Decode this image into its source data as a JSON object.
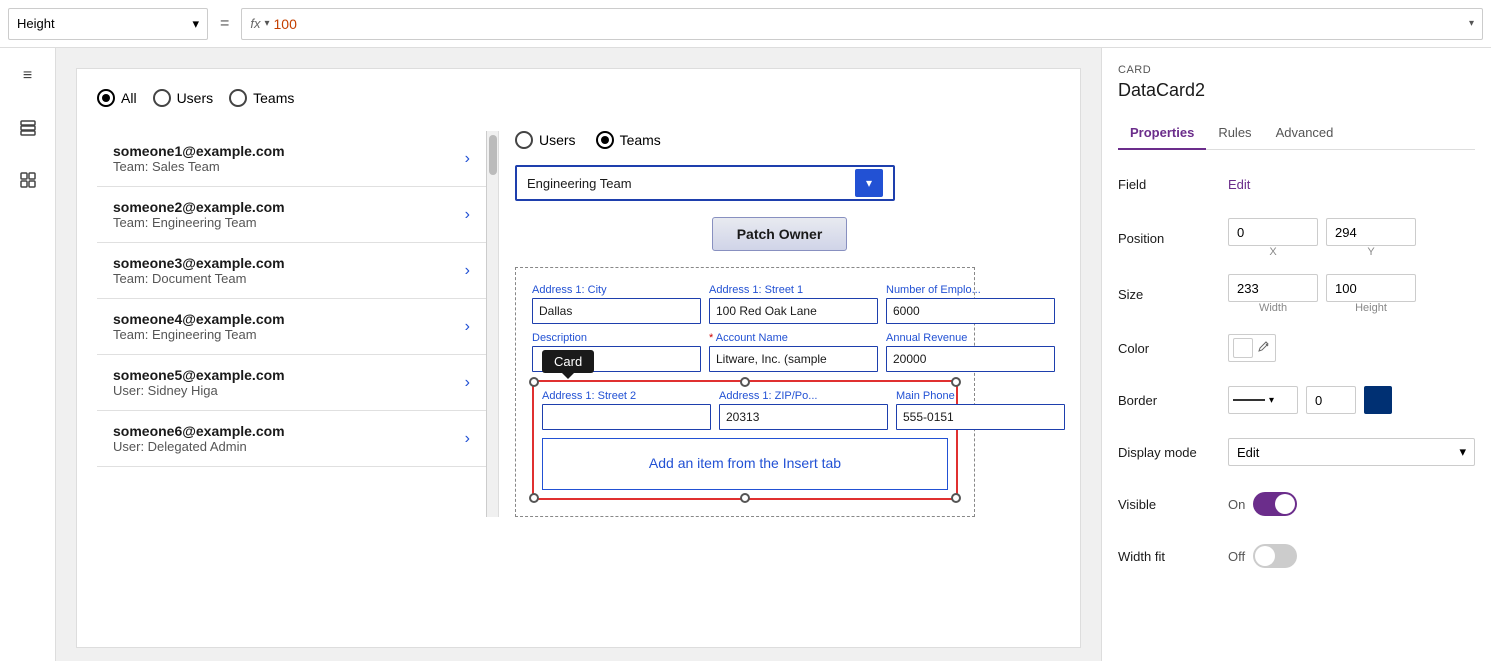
{
  "topbar": {
    "height_label": "Height",
    "equals_symbol": "=",
    "fx_label": "fx",
    "fx_value": "100"
  },
  "sidebar_icons": [
    {
      "name": "hamburger-icon",
      "symbol": "≡"
    },
    {
      "name": "layers-icon",
      "symbol": "⧉"
    },
    {
      "name": "grid-icon",
      "symbol": "⊞"
    }
  ],
  "canvas": {
    "radio_group": {
      "all_label": "All",
      "users_label": "Users",
      "teams_label": "Teams"
    },
    "people": [
      {
        "email": "someone1@example.com",
        "team": "Team: Sales Team"
      },
      {
        "email": "someone2@example.com",
        "team": "Team: Engineering Team"
      },
      {
        "email": "someone3@example.com",
        "team": "Team: Document Team"
      },
      {
        "email": "someone4@example.com",
        "team": "Team: Engineering Team"
      },
      {
        "email": "someone5@example.com",
        "team": "User: Sidney Higa"
      },
      {
        "email": "someone6@example.com",
        "team": "User: Delegated Admin"
      }
    ],
    "form": {
      "radio_users_label": "Users",
      "radio_teams_label": "Teams",
      "dropdown_value": "Engineering Team",
      "patch_owner_label": "Patch Owner",
      "card_tooltip": "Card",
      "insert_placeholder": "Add an item from the Insert tab",
      "fields": [
        {
          "label": "Address 1: City",
          "value": "Dallas",
          "required": false
        },
        {
          "label": "Address 1: Street 1",
          "value": "100 Red Oak Lane",
          "required": false
        },
        {
          "label": "Number of Emplo...",
          "value": "6000",
          "required": false
        },
        {
          "label": "Description",
          "value": "",
          "required": false
        },
        {
          "label": "Account Name",
          "value": "Litware, Inc. (sample",
          "required": true
        },
        {
          "label": "Annual Revenue",
          "value": "20000",
          "required": false
        },
        {
          "label": "Address 1: Street 2",
          "value": "",
          "required": false
        },
        {
          "label": "Address 1: ZIP/Po...",
          "value": "20313",
          "required": false
        },
        {
          "label": "Main Phone",
          "value": "555-0151",
          "required": false
        }
      ]
    }
  },
  "props_panel": {
    "card_label": "CARD",
    "title": "DataCard2",
    "tabs": [
      "Properties",
      "Rules",
      "Advanced"
    ],
    "active_tab": "Properties",
    "field_label": "Field",
    "field_edit": "Edit",
    "position_label": "Position",
    "position_x": "0",
    "position_y": "294",
    "x_label": "X",
    "y_label": "Y",
    "size_label": "Size",
    "size_width": "233",
    "size_height": "100",
    "width_label": "Width",
    "height_label": "Height",
    "color_label": "Color",
    "border_label": "Border",
    "border_width": "0",
    "display_mode_label": "Display mode",
    "display_mode_value": "Edit",
    "visible_label": "Visible",
    "visible_value": "On",
    "width_fit_label": "Width fit",
    "width_fit_value": "Off"
  }
}
